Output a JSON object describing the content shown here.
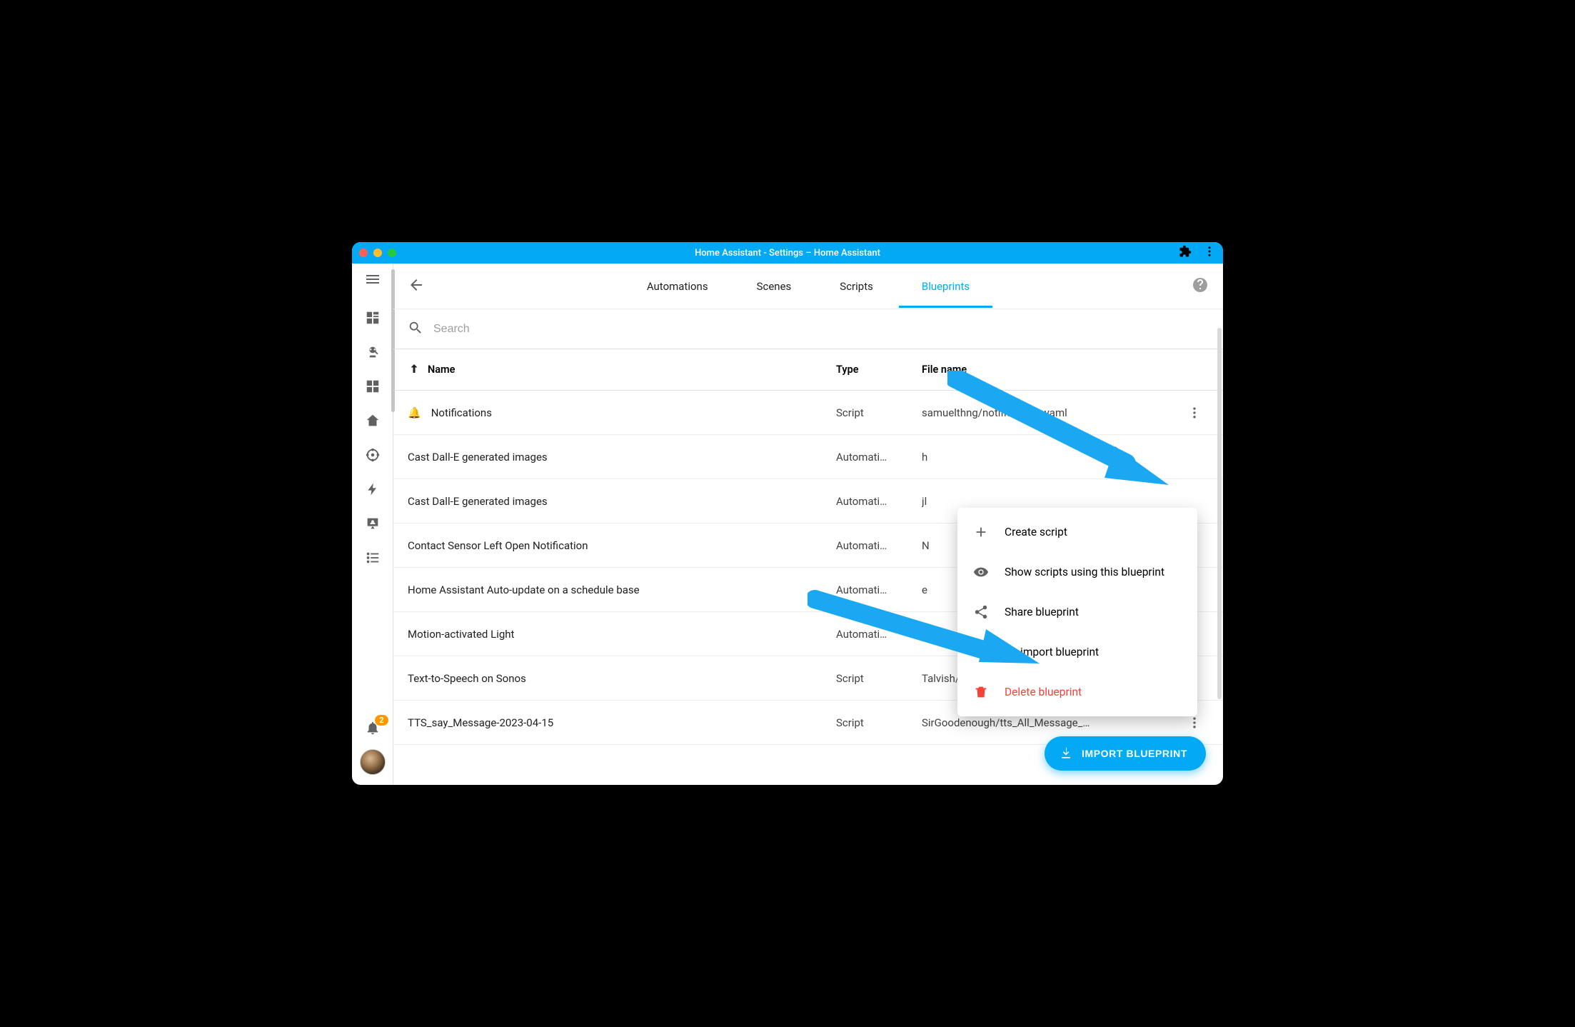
{
  "window_title": "Home Assistant - Settings – Home Assistant",
  "tabs": {
    "automations": "Automations",
    "scenes": "Scenes",
    "scripts": "Scripts",
    "blueprints": "Blueprints"
  },
  "search": {
    "placeholder": "Search"
  },
  "columns": {
    "name": "Name",
    "type": "Type",
    "file": "File name"
  },
  "rows": [
    {
      "icon": "🔔",
      "name": "Notifications",
      "type": "Script",
      "file": "samuelthng/notifications.yaml"
    },
    {
      "icon": "",
      "name": "Cast Dall-E generated images",
      "type": "Automati…",
      "file": "h"
    },
    {
      "icon": "",
      "name": "Cast Dall-E generated images",
      "type": "Automati…",
      "file": "jl"
    },
    {
      "icon": "",
      "name": "Contact Sensor Left Open Notification",
      "type": "Automati…",
      "file": "N"
    },
    {
      "icon": "",
      "name": "Home Assistant Auto-update on a schedule base",
      "type": "Automati…",
      "file": "e"
    },
    {
      "icon": "",
      "name": "Motion-activated Light",
      "type": "Automati…",
      "file": "h"
    },
    {
      "icon": "",
      "name": "Text-to-Speech on Sonos",
      "type": "Script",
      "file": "Talvish/sonos_say.y…"
    },
    {
      "icon": "",
      "name": "TTS_say_Message-2023-04-15",
      "type": "Script",
      "file": "SirGoodenough/tts_All_Message_…"
    }
  ],
  "context_menu": {
    "create": "Create script",
    "show": "Show scripts using this blueprint",
    "share": "Share blueprint",
    "reimport": "Re-import blueprint",
    "delete": "Delete blueprint"
  },
  "fab_label": "IMPORT BLUEPRINT",
  "notifications_badge": "2"
}
